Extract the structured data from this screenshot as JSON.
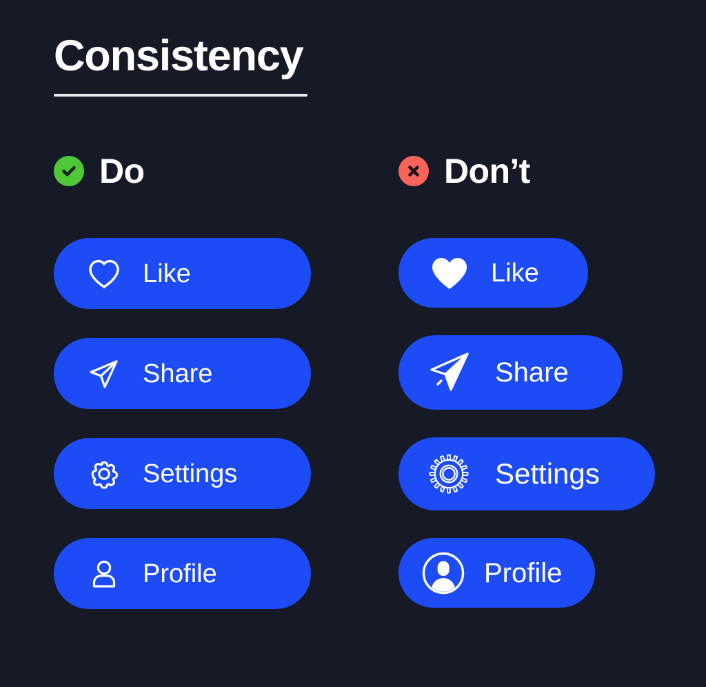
{
  "page": {
    "title": "Consistency",
    "background_color": "#161a26",
    "accent_blue": "#1d4bf5",
    "good_color": "#4fc838",
    "bad_color": "#f8635c",
    "text_color": "#ffffff",
    "rule_color": "#e9eaee"
  },
  "columns": [
    {
      "key": "do",
      "heading": "Do",
      "badge_icon": "check-circle-icon",
      "badge_color": "#4fc838",
      "buttons": [
        {
          "label": "Like",
          "icon": "heart-outline-icon",
          "icon_style": "outline"
        },
        {
          "label": "Share",
          "icon": "paper-plane-outline-icon",
          "icon_style": "outline"
        },
        {
          "label": "Settings",
          "icon": "gear-outline-icon",
          "icon_style": "outline"
        },
        {
          "label": "Profile",
          "icon": "person-outline-icon",
          "icon_style": "outline"
        }
      ]
    },
    {
      "key": "dont",
      "heading": "Don’t",
      "badge_icon": "x-circle-icon",
      "badge_color": "#f8635c",
      "buttons": [
        {
          "label": "Like",
          "icon": "heart-filled-icon",
          "icon_style": "filled"
        },
        {
          "label": "Share",
          "icon": "paper-plane-half-filled-icon",
          "icon_style": "half-filled"
        },
        {
          "label": "Settings",
          "icon": "gear-fine-teeth-icon",
          "icon_style": "outline-detailed"
        },
        {
          "label": "Profile",
          "icon": "person-avatar-filled-icon",
          "icon_style": "filled-circle"
        }
      ]
    }
  ]
}
